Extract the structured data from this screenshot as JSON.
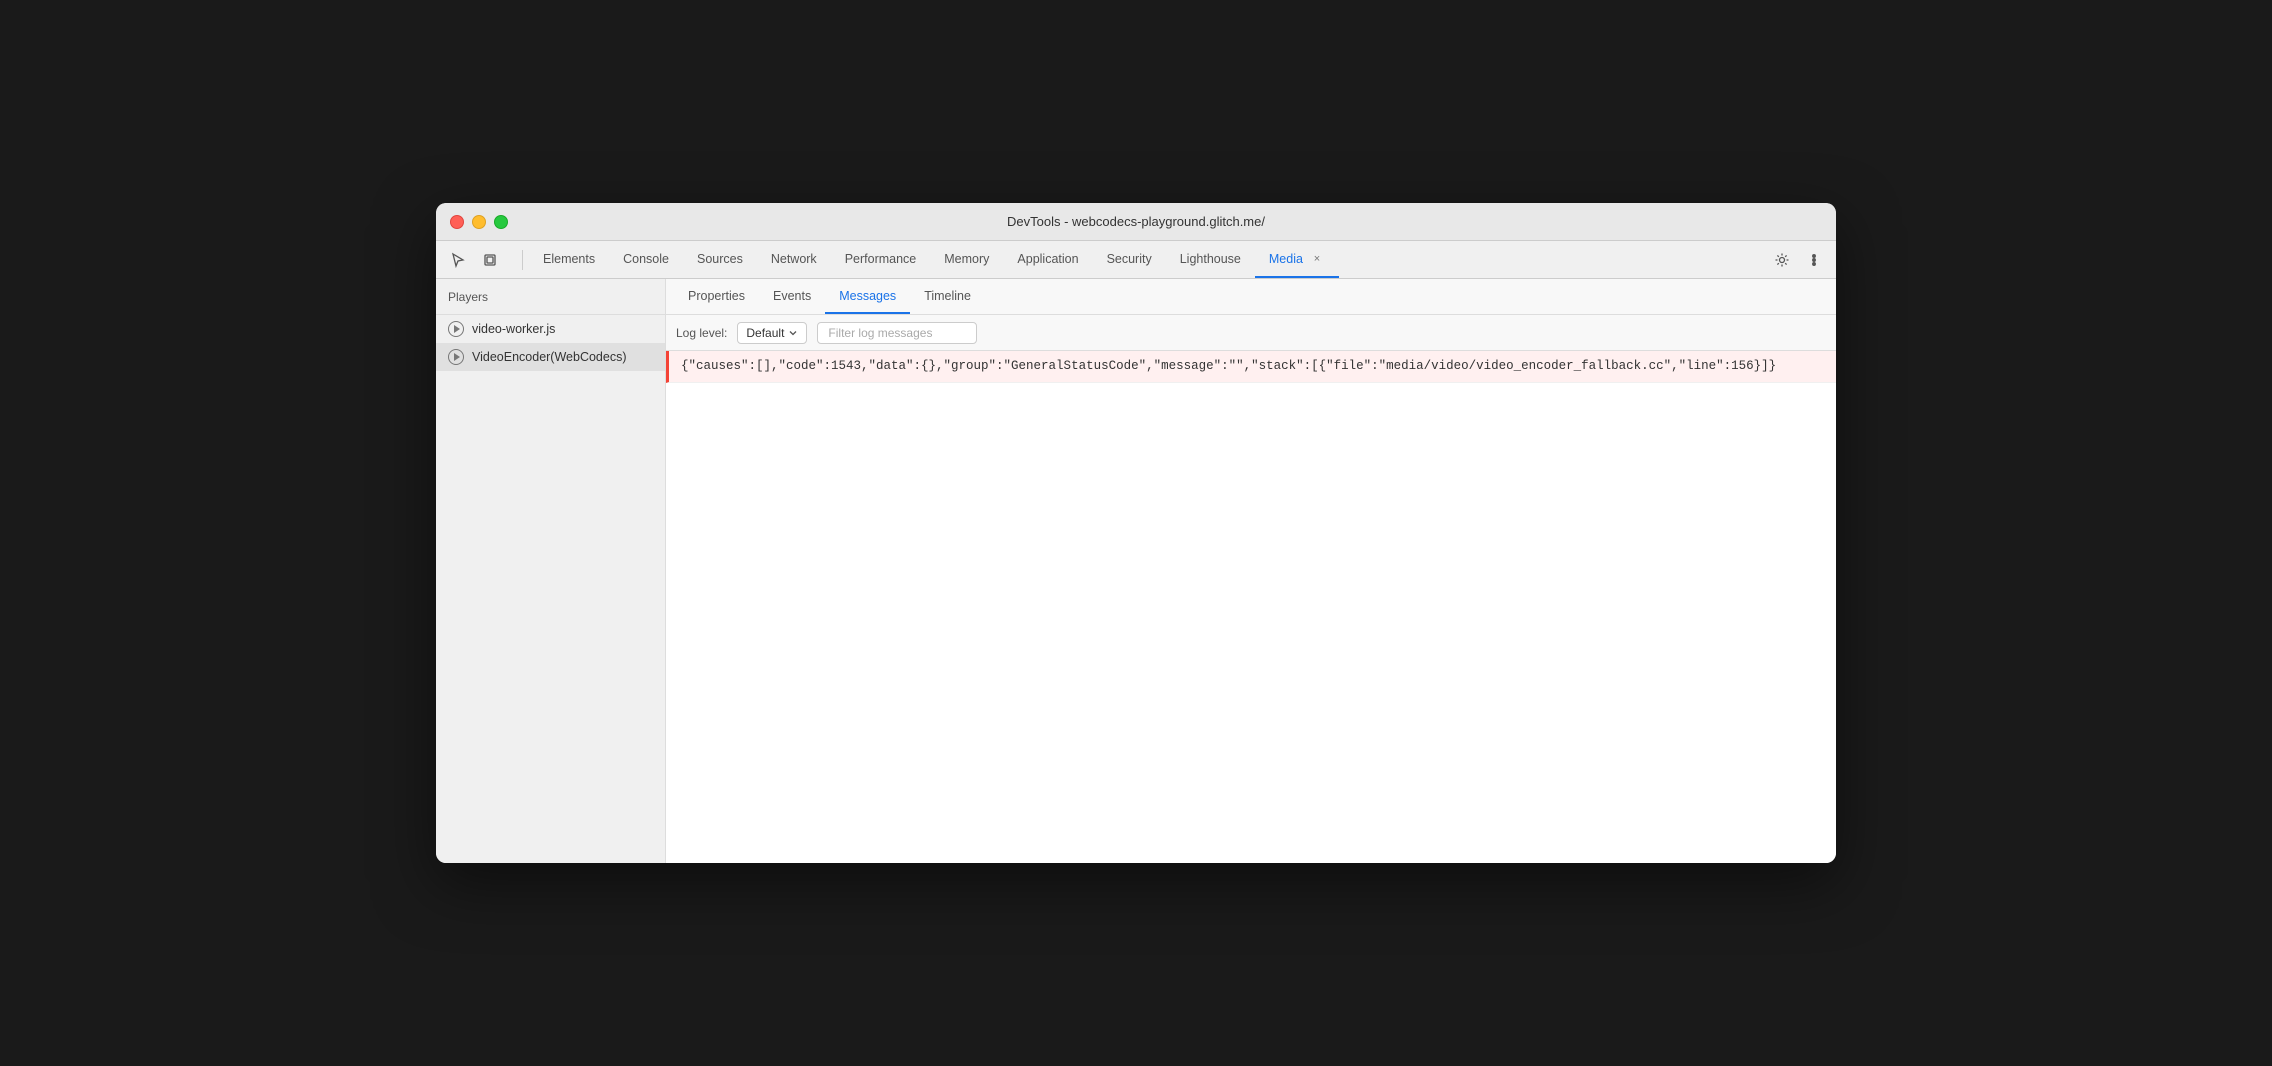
{
  "window": {
    "title": "DevTools - webcodecs-playground.glitch.me/"
  },
  "traffic_lights": {
    "red_label": "close",
    "yellow_label": "minimize",
    "green_label": "maximize"
  },
  "toolbar": {
    "cursor_icon": "cursor-icon",
    "layers_icon": "layers-icon",
    "tabs": [
      {
        "id": "elements",
        "label": "Elements",
        "active": false
      },
      {
        "id": "console",
        "label": "Console",
        "active": false
      },
      {
        "id": "sources",
        "label": "Sources",
        "active": false
      },
      {
        "id": "network",
        "label": "Network",
        "active": false
      },
      {
        "id": "performance",
        "label": "Performance",
        "active": false
      },
      {
        "id": "memory",
        "label": "Memory",
        "active": false
      },
      {
        "id": "application",
        "label": "Application",
        "active": false
      },
      {
        "id": "security",
        "label": "Security",
        "active": false
      },
      {
        "id": "lighthouse",
        "label": "Lighthouse",
        "active": false
      },
      {
        "id": "media",
        "label": "Media",
        "active": true,
        "closable": true
      }
    ],
    "settings_icon": "settings-icon",
    "more_icon": "more-icon"
  },
  "sidebar": {
    "header": "Players",
    "items": [
      {
        "id": "video-worker",
        "label": "video-worker.js",
        "selected": false
      },
      {
        "id": "video-encoder",
        "label": "VideoEncoder(WebCodecs)",
        "selected": true
      }
    ]
  },
  "content": {
    "tabs": [
      {
        "id": "properties",
        "label": "Properties",
        "active": false
      },
      {
        "id": "events",
        "label": "Events",
        "active": false
      },
      {
        "id": "messages",
        "label": "Messages",
        "active": true
      },
      {
        "id": "timeline",
        "label": "Timeline",
        "active": false
      }
    ],
    "filter_bar": {
      "log_level_label": "Log level:",
      "log_level_value": "Default",
      "dropdown_icon": "chevron-down-icon",
      "filter_placeholder": "Filter log messages"
    },
    "messages": [
      {
        "id": "msg-1",
        "type": "error",
        "text": "{\"causes\":[],\"code\":1543,\"data\":{},\"group\":\"GeneralStatusCode\",\"message\":\"\",\"stack\":[{\"file\":\"media/video/video_encoder_fallback.cc\",\"line\":156}]}"
      }
    ]
  }
}
